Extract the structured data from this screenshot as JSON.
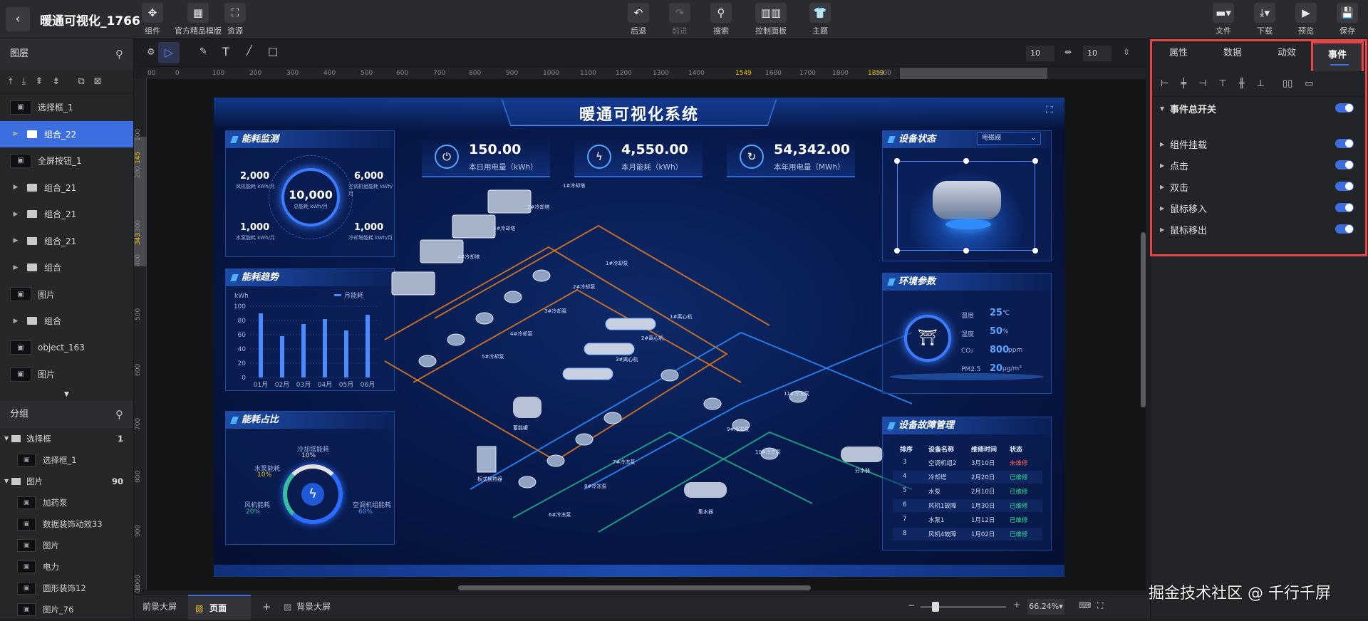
{
  "app": {
    "title": "暖通可视化_1766",
    "back_icon": "chevron-left-icon"
  },
  "toolbar": {
    "left": [
      {
        "label": "组件",
        "icon": "component-icon"
      },
      {
        "label": "官方精品模版",
        "icon": "template-grid-icon"
      },
      {
        "label": "资源",
        "icon": "resource-icon"
      }
    ],
    "center": [
      {
        "label": "后退",
        "icon": "undo-icon"
      },
      {
        "label": "前进",
        "icon": "redo-icon"
      },
      {
        "label": "搜索",
        "icon": "search-icon"
      },
      {
        "label": "控制面板",
        "icon": "panel-icon"
      },
      {
        "label": "主题",
        "icon": "theme-icon"
      }
    ],
    "right": [
      {
        "label": "文件",
        "icon": "folder-icon"
      },
      {
        "label": "下载",
        "icon": "download-icon"
      },
      {
        "label": "预览",
        "icon": "play-icon"
      },
      {
        "label": "保存",
        "icon": "save-icon"
      }
    ]
  },
  "layers": {
    "title": "图层",
    "items": [
      {
        "name": "选择框_1",
        "type": "image",
        "selected": false
      },
      {
        "name": "组合_22",
        "type": "group",
        "selected": true
      },
      {
        "name": "全屏按钮_1",
        "type": "image",
        "selected": false
      },
      {
        "name": "组合_21",
        "type": "group",
        "selected": false
      },
      {
        "name": "组合_21",
        "type": "group",
        "selected": false
      },
      {
        "name": "组合_21",
        "type": "group",
        "selected": false
      },
      {
        "name": "组合",
        "type": "group",
        "selected": false
      },
      {
        "name": "图片",
        "type": "image",
        "selected": false
      },
      {
        "name": "组合",
        "type": "group",
        "selected": false
      },
      {
        "name": "object_163",
        "type": "image",
        "selected": false
      },
      {
        "name": "图片",
        "type": "image",
        "selected": false
      }
    ]
  },
  "groups": {
    "title": "分组",
    "items": [
      {
        "name": "选择框",
        "count": "1",
        "level": 0
      },
      {
        "name": "选择框_1",
        "count": "",
        "level": 1
      },
      {
        "name": "图片",
        "count": "90",
        "level": 0
      },
      {
        "name": "加药泵",
        "count": "",
        "level": 1
      },
      {
        "name": "数据装饰动效33",
        "count": "",
        "level": 1
      },
      {
        "name": "图片",
        "count": "",
        "level": 1
      },
      {
        "name": "电力",
        "count": "",
        "level": 1
      },
      {
        "name": "圆形装饰12",
        "count": "",
        "level": 1
      },
      {
        "name": "图片_76",
        "count": "",
        "level": 1
      }
    ]
  },
  "canvas_tools": {
    "x_value": "10",
    "y_value": "10"
  },
  "ruler": {
    "h_ticks": [
      "-100",
      "0",
      "100",
      "200",
      "300",
      "400",
      "500",
      "600",
      "700",
      "800",
      "900",
      "1000",
      "1100",
      "1200",
      "1300",
      "1400",
      "1549",
      "1600",
      "1700",
      "1800",
      "1859",
      "1900"
    ],
    "v_ticks": [
      "100",
      "145",
      "200",
      "300",
      "343",
      "400",
      "500",
      "600",
      "700",
      "800",
      "900",
      "1000",
      "1100"
    ]
  },
  "dashboard": {
    "title": "暖通可视化系统",
    "panels": {
      "energy_monitor": "能耗监测",
      "energy_trend": "能耗趋势",
      "energy_share": "能耗占比",
      "device_status": "设备状态",
      "environment": "环境参数",
      "fault_mgmt": "设备故障管理"
    },
    "metrics": [
      {
        "value": "150.00",
        "label": "本日用电量（kWh）"
      },
      {
        "value": "4,550.00",
        "label": "本月能耗（kWh）"
      },
      {
        "value": "54,342.00",
        "label": "本年用电量（MWh）"
      }
    ],
    "monitor": {
      "center_value": "10,000",
      "center_label": "总能耗 kWh/月",
      "tl_value": "2,000",
      "tl_label": "风机能耗 kWh/月",
      "tr_value": "6,000",
      "tr_label": "空调机组能耗 kWh/月",
      "bl_value": "1,000",
      "bl_label": "水泵能耗 kWh/月",
      "br_value": "1,000",
      "br_label": "冷却塔能耗 kWh/月"
    },
    "trend": {
      "unit": "kWh",
      "legend": "月能耗",
      "categories": [
        "01月",
        "02月",
        "03月",
        "04月",
        "05月",
        "06月"
      ],
      "values": [
        90,
        58,
        75,
        82,
        66,
        88
      ],
      "yticks": [
        "100",
        "80",
        "60",
        "40",
        "20",
        "0"
      ]
    },
    "share": [
      {
        "label": "冷却塔能耗",
        "pct": "10%"
      },
      {
        "label": "水泵能耗",
        "pct": "10%"
      },
      {
        "label": "风机能耗",
        "pct": "20%"
      },
      {
        "label": "空调机组能耗",
        "pct": "60%"
      }
    ],
    "device_select": "电磁阀",
    "environment": [
      {
        "label": "温度",
        "value": "25",
        "unit": "℃"
      },
      {
        "label": "湿度",
        "value": "50",
        "unit": "%"
      },
      {
        "label": "CO₂",
        "value": "800",
        "unit": "ppm"
      },
      {
        "label": "PM2.5",
        "value": "20",
        "unit": "μg/m³"
      }
    ],
    "fault_headers": [
      "排序",
      "设备名称",
      "维修时间",
      "状态"
    ],
    "fault_rows": [
      [
        "3",
        "空调机组2",
        "3月10日",
        "未维修"
      ],
      [
        "4",
        "冷却塔",
        "2月20日",
        "已维修"
      ],
      [
        "5",
        "水泵",
        "2月10日",
        "已维修"
      ],
      [
        "6",
        "风机1故障",
        "1月30日",
        "已维修"
      ],
      [
        "7",
        "水泵1",
        "1月12日",
        "已维修"
      ],
      [
        "8",
        "风机4故障",
        "1月02日",
        "已维修"
      ]
    ],
    "scene_labels": [
      "1#冷却塔",
      "2#冷却塔",
      "3#冷却塔",
      "4#冷却塔",
      "1#冷却泵",
      "2#冷却泵",
      "3#冷却泵",
      "4#冷却泵",
      "5#冷却泵",
      "1#离心机",
      "2#离心机",
      "3#离心机",
      "蓄能罐",
      "板式换热器",
      "7#冷冻泵",
      "8#冷冻泵",
      "9#冷冻泵",
      "10#冷冻泵",
      "11#冷冻泵",
      "6#冷冻泵",
      "集水器",
      "分水器"
    ]
  },
  "props_panel": {
    "tabs": [
      "属性",
      "数据",
      "动效",
      "事件"
    ],
    "active_tab": "事件",
    "master_switch": "事件总开关",
    "events": [
      "组件挂载",
      "点击",
      "双击",
      "鼠标移入",
      "鼠标移出"
    ]
  },
  "bottom": {
    "tabs": [
      "前景大屏",
      "页面",
      "背景大屏"
    ],
    "active_tab": "页面",
    "zoom": "66.24%"
  },
  "watermark": "掘金技术社区 @ 千行千屏",
  "colors": {
    "accent": "#3d6ee0",
    "highlight": "#e64545",
    "screen_bg": "#081a4d"
  }
}
